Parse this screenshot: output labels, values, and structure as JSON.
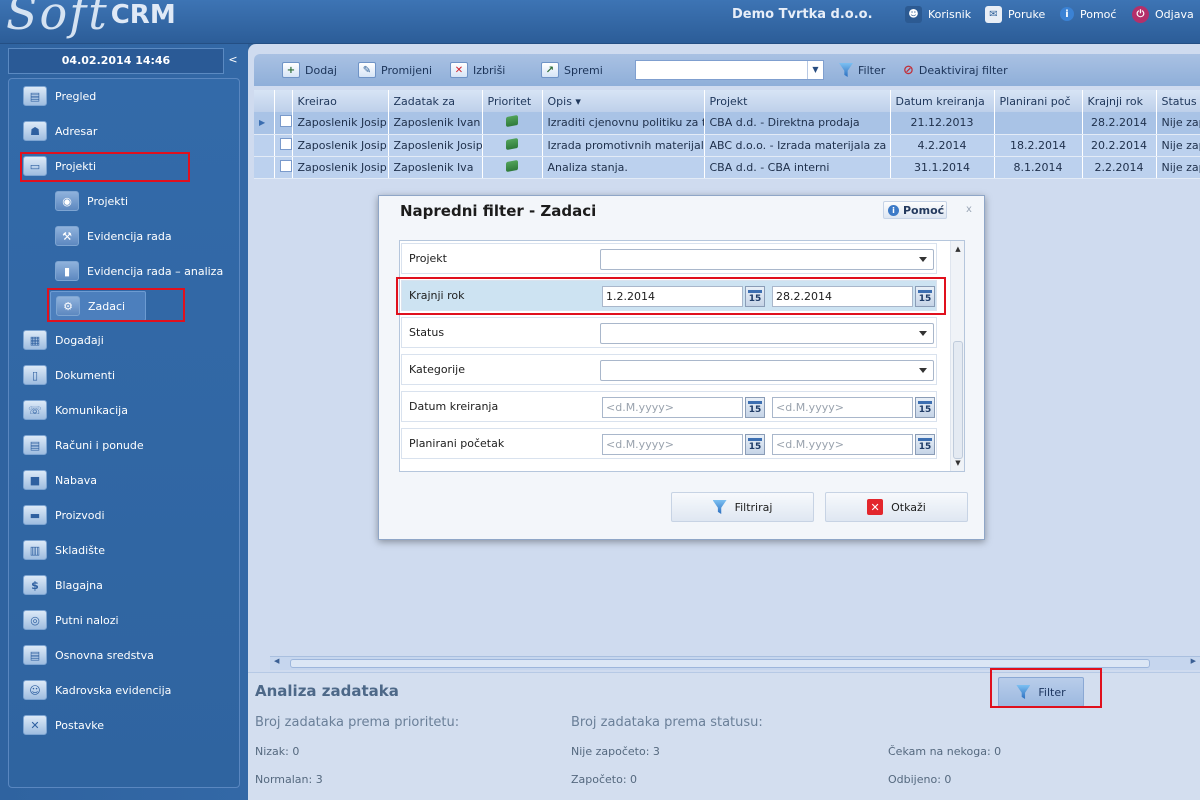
{
  "app": {
    "logo_soft": "Soft",
    "logo_crm": "CRM",
    "company": "Demo Tvrtka d.o.o."
  },
  "topnav": {
    "user": "Korisnik",
    "messages": "Poruke",
    "help": "Pomoć",
    "logout": "Odjava"
  },
  "sidebar": {
    "datetime": "04.02.2014 14:46",
    "collapse": "<",
    "items": [
      {
        "label": "Pregled",
        "icon": "overview-icon"
      },
      {
        "label": "Adresar",
        "icon": "address-book-icon"
      },
      {
        "label": "Projekti",
        "icon": "projects-icon"
      },
      {
        "label": "Projekti",
        "icon": "projects-sub-icon"
      },
      {
        "label": "Evidencija rada",
        "icon": "wrench-icon"
      },
      {
        "label": "Evidencija rada – analiza",
        "icon": "bar-chart-icon"
      },
      {
        "label": "Zadaci",
        "icon": "gear-icon"
      },
      {
        "label": "Događaji",
        "icon": "calendar-icon"
      },
      {
        "label": "Dokumenti",
        "icon": "documents-icon"
      },
      {
        "label": "Komunikacija",
        "icon": "phone-icon"
      },
      {
        "label": "Računi i ponude",
        "icon": "invoice-icon"
      },
      {
        "label": "Nabava",
        "icon": "procurement-icon"
      },
      {
        "label": "Proizvodi",
        "icon": "products-icon"
      },
      {
        "label": "Skladište",
        "icon": "warehouse-icon"
      },
      {
        "label": "Blagajna",
        "icon": "cash-register-icon"
      },
      {
        "label": "Putni nalozi",
        "icon": "travel-icon"
      },
      {
        "label": "Osnovna sredstva",
        "icon": "assets-icon"
      },
      {
        "label": "Kadrovska evidencija",
        "icon": "people-icon"
      },
      {
        "label": "Postavke",
        "icon": "settings-icon"
      }
    ]
  },
  "toolbar": {
    "add": "Dodaj",
    "edit": "Promijeni",
    "delete": "Izbriši",
    "save": "Spremi",
    "filter": "Filter",
    "deactivate_filter": "Deaktiviraj filter",
    "combo_value": ""
  },
  "grid": {
    "columns": [
      "Kreirao",
      "Zadatak za",
      "Prioritet",
      "Opis ▾",
      "Projekt",
      "Datum kreiranja",
      "Planirani poč",
      "Krajnji rok",
      "Status"
    ],
    "rows": [
      {
        "kreirao": "Zaposlenik Josip",
        "zadatak_za": "Zaposlenik Ivan",
        "opis": "Izraditi cjenovnu politiku za tr",
        "projekt": "CBA d.d. - Direktna prodaja",
        "datum_kreiranja": "21.12.2013",
        "planirani_poc": "",
        "krajnji_rok": "28.2.2014",
        "status": "Nije zap"
      },
      {
        "kreirao": "Zaposlenik Josip",
        "zadatak_za": "Zaposlenik Josip",
        "opis": "Izrada promotivnih materijala.",
        "projekt": "ABC d.o.o. - Izrada materijala za p",
        "datum_kreiranja": "4.2.2014",
        "planirani_poc": "18.2.2014",
        "krajnji_rok": "20.2.2014",
        "status": "Nije zap"
      },
      {
        "kreirao": "Zaposlenik Josip",
        "zadatak_za": "Zaposlenik Iva",
        "opis": "Analiza stanja.",
        "projekt": "CBA d.d. - CBA interni",
        "datum_kreiranja": "31.1.2014",
        "planirani_poc": "8.1.2014",
        "krajnji_rok": "2.2.2014",
        "status": "Nije zap"
      }
    ]
  },
  "analysis": {
    "title": "Analiza zadataka",
    "filter_button": "Filter",
    "by_priority_title": "Broj zadataka prema prioritetu:",
    "by_status_title": "Broj zadataka prema statusu:",
    "nizak": "Nizak: 0",
    "normalan": "Normalan: 3",
    "nije_zapoceto": "Nije započeto: 3",
    "zapoceto": "Započeto: 0",
    "cekam": "Čekam na nekoga: 0",
    "odbijeno": "Odbijeno: 0"
  },
  "dialog": {
    "title": "Napredni filter - Zadaci",
    "help": "Pomoć",
    "close": "x",
    "fields": {
      "projekt": {
        "label": "Projekt",
        "value": ""
      },
      "krajnji_rok": {
        "label": "Krajnji rok",
        "from": "1.2.2014",
        "to": "28.2.2014"
      },
      "status": {
        "label": "Status",
        "value": ""
      },
      "kategorije": {
        "label": "Kategorije",
        "value": ""
      },
      "datum_kreiranja": {
        "label": "Datum kreiranja",
        "from_placeholder": "<d.M.yyyy>",
        "to_placeholder": "<d.M.yyyy>"
      },
      "planirani_pocetak": {
        "label": "Planirani početak",
        "from_placeholder": "<d.M.yyyy>",
        "to_placeholder": "<d.M.yyyy>"
      }
    },
    "cal_day": "15",
    "filter_button": "Filtriraj",
    "cancel_button": "Otkaži"
  },
  "colors": {
    "accent": "#2d5f98",
    "highlight": "#e0101d",
    "selected_row": "#a9c3e6"
  }
}
